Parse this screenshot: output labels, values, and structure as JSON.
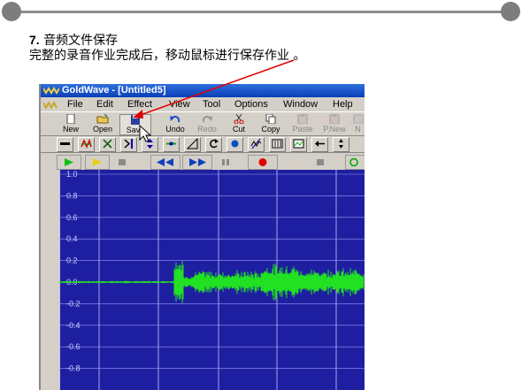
{
  "slide": {
    "step_number": "7.",
    "step_title": "音频文件保存",
    "description": "完整的录音作业完成后，移动鼠标进行保存作业 。"
  },
  "window": {
    "app_name": "GoldWave",
    "title": "GoldWave - [Untitled5]"
  },
  "menu": [
    "File",
    "Edit",
    "Effect",
    "View",
    "Tool",
    "Options",
    "Window",
    "Help"
  ],
  "toolbar": {
    "new": "New",
    "open": "Open",
    "save": "Save",
    "undo": "Undo",
    "redo": "Redo",
    "cut": "Cut",
    "copy": "Copy",
    "paste": "Paste",
    "pnew": "P.New",
    "partial": "N"
  },
  "waveform": {
    "y_ticks": [
      "1.0",
      "0.8",
      "0.6",
      "0.4",
      "0.2",
      "0.0",
      "-0.2",
      "-0.4",
      "-0.6",
      "-0.8"
    ],
    "background_color": "#1e1fa0",
    "wave_color": "#22e022"
  },
  "annotation_color": "#e00000"
}
